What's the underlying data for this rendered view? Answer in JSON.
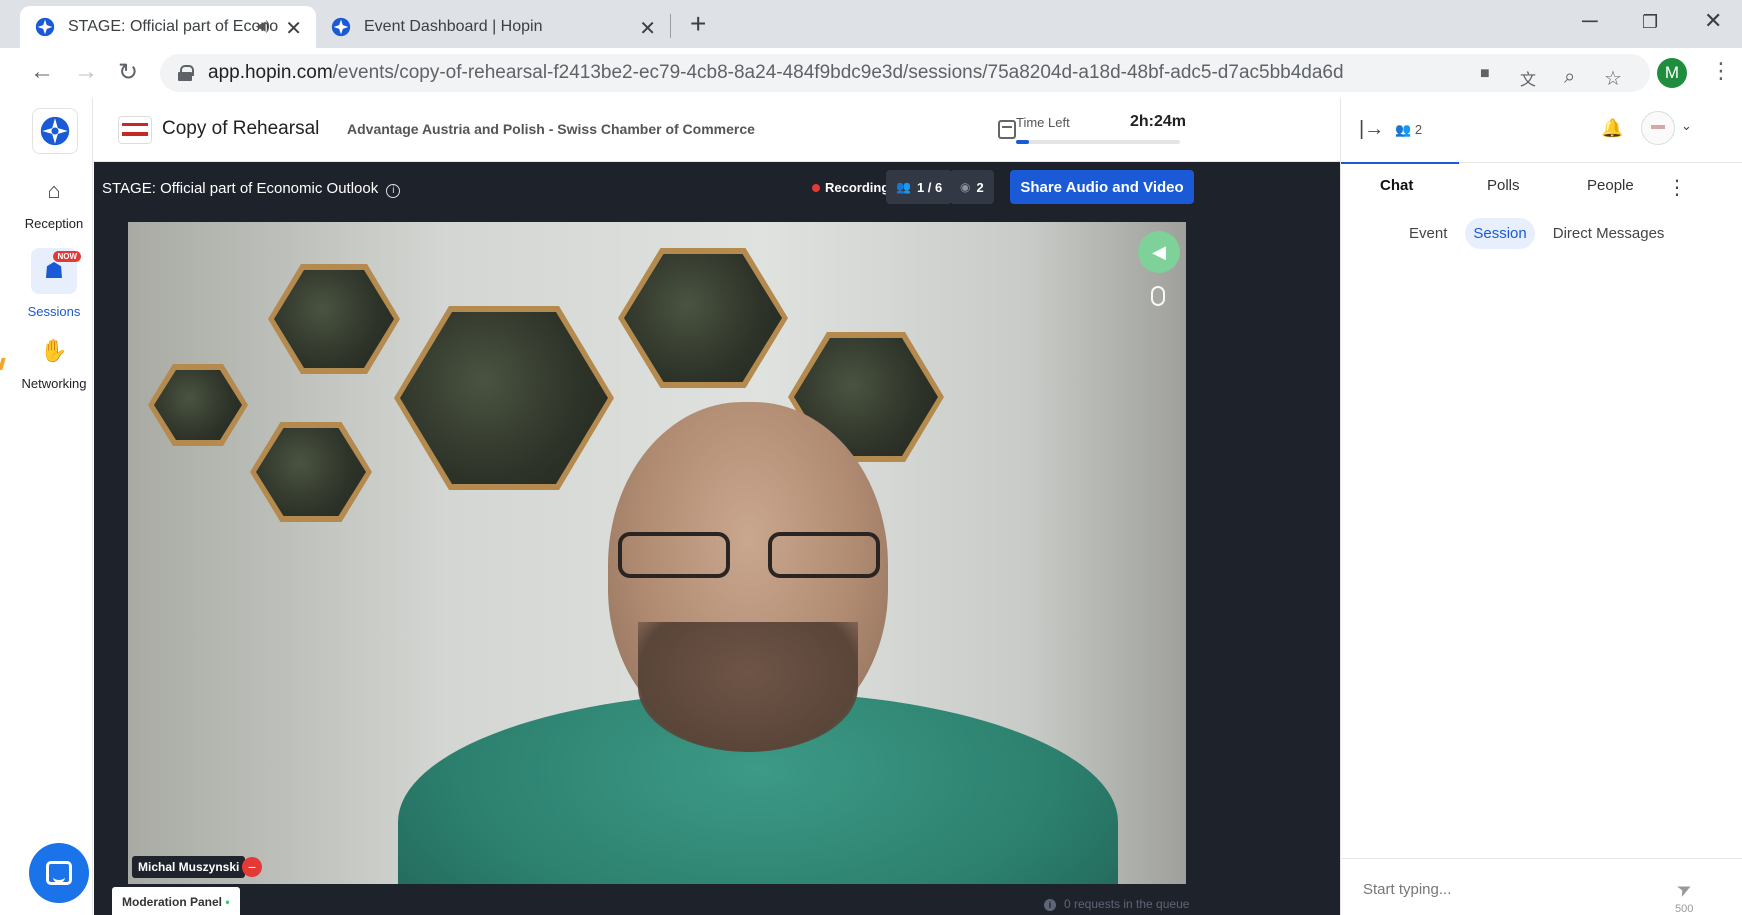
{
  "browser": {
    "tabs": [
      {
        "title": "STAGE: Official part of Econo",
        "active": true
      },
      {
        "title": "Event Dashboard | Hopin",
        "active": false
      }
    ],
    "url_host": "app.hopin.com",
    "url_path": "/events/copy-of-rehearsal-f2413be2-ec79-4cb8-8a24-484f9bdc9e3d/sessions/75a8204d-a18d-48bf-adc5-d7ac5bb4da6d",
    "profile_initial": "M",
    "profile_color": "#1e8e3e"
  },
  "nav": {
    "items": [
      {
        "label": "Reception",
        "icon": "home-icon"
      },
      {
        "label": "Sessions",
        "icon": "sessions-icon",
        "badge": "NOW",
        "active": true
      },
      {
        "label": "Networking",
        "icon": "handshake-icon"
      }
    ]
  },
  "event": {
    "name": "Copy of Rehearsal",
    "organizer": "Advantage Austria and Polish - Swiss Chamber of Commerce",
    "time_left_label": "Time Left",
    "time_left_value": "2h:24m",
    "time_progress": 0.08
  },
  "stage": {
    "title": "STAGE: Official part of Economic Outlook",
    "recording_label": "Recording",
    "participants": "1 / 6",
    "viewers": "2",
    "share_button": "Share Audio and Video",
    "speaker_name": "Michal Muszynski",
    "moderation_panel": "Moderation Panel",
    "queue_text": "0 requests in the queue"
  },
  "panel": {
    "people_count": "2",
    "tabs": [
      "Chat",
      "Polls",
      "People"
    ],
    "active_tab": "Chat",
    "subtabs": [
      "Event",
      "Session",
      "Direct Messages"
    ],
    "active_subtab": "Session",
    "input_placeholder": "Start typing...",
    "char_limit": "500"
  },
  "colors": {
    "accent": "#1a5ad7",
    "stage_bg": "#1e222b",
    "recording": "#e53935"
  }
}
